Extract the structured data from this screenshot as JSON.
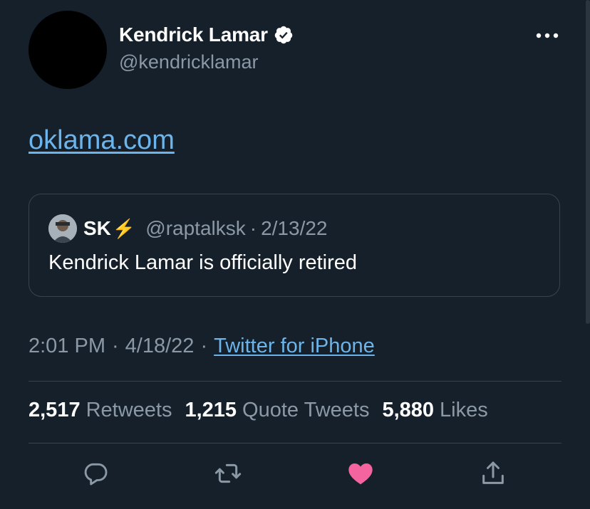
{
  "author": {
    "name": "Kendrick Lamar",
    "handle": "@kendricklamar",
    "verified": true
  },
  "tweet": {
    "link_text": "oklama.com"
  },
  "quoted_tweet": {
    "name": "SK",
    "name_emoji": "⚡",
    "handle": "@raptalksk",
    "separator": "·",
    "date": "2/13/22",
    "text": "Kendrick Lamar is officially retired"
  },
  "meta": {
    "time": "2:01 PM",
    "separator": "·",
    "date": "4/18/22",
    "source": "Twitter for iPhone"
  },
  "stats": [
    {
      "count": "2,517",
      "label": "Retweets"
    },
    {
      "count": "1,215",
      "label": "Quote Tweets"
    },
    {
      "count": "5,880",
      "label": "Likes"
    }
  ],
  "actions": [
    "reply-icon",
    "retweet-icon",
    "like-icon",
    "share-icon"
  ],
  "colors": {
    "background": "#15202b",
    "link": "#6cb4ea",
    "secondary_text": "#8b98a5",
    "border": "#38444d",
    "like": "#f4649e"
  }
}
